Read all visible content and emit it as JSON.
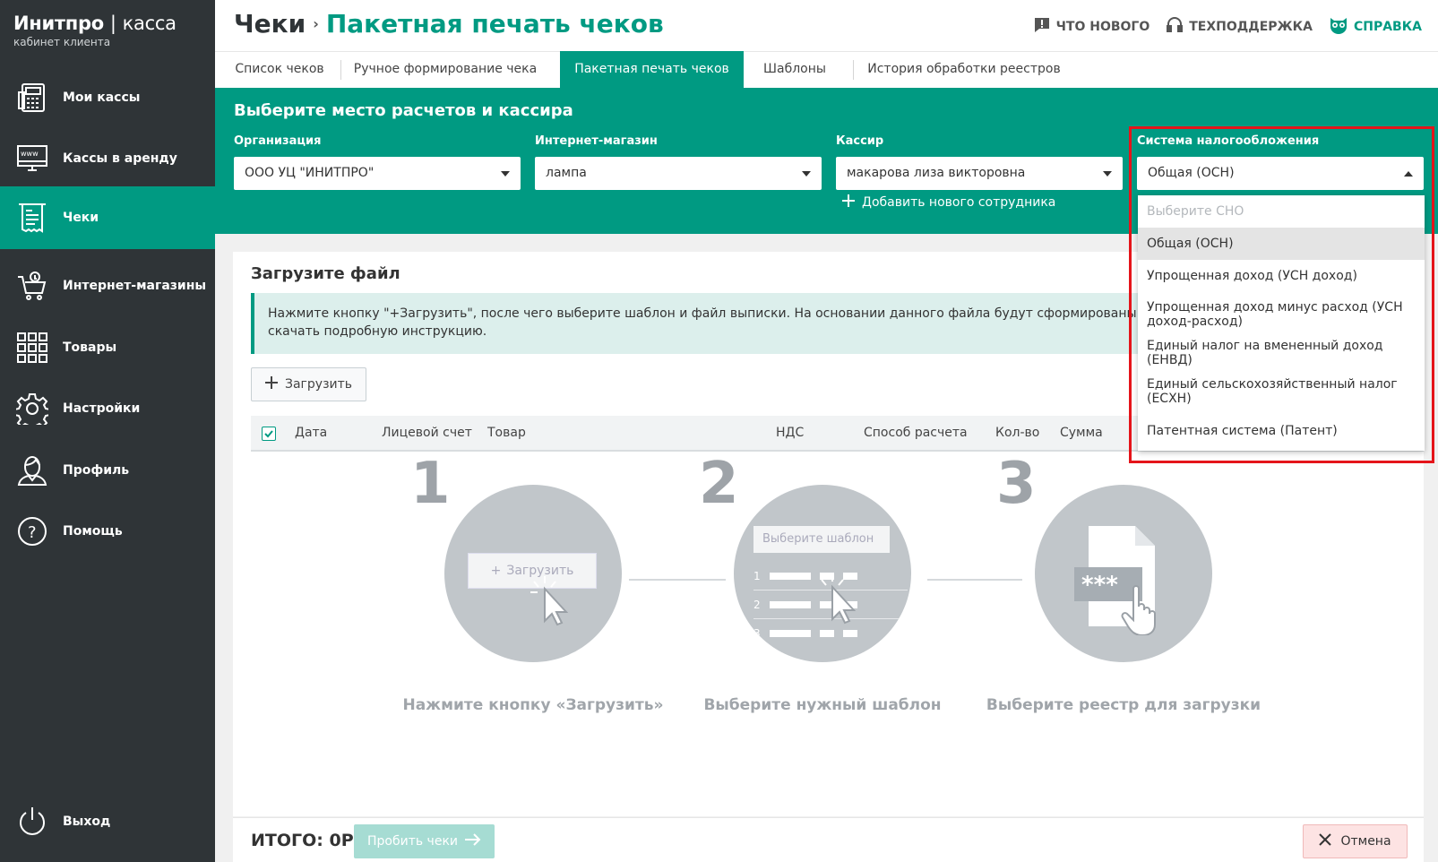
{
  "brand": {
    "name_bold": "Инитпро",
    "name_light": "касса",
    "subtitle": "кабинет клиента"
  },
  "sidebar": {
    "items": [
      {
        "label": "Мои кассы",
        "icon": "cash-register-icon"
      },
      {
        "label": "Кассы в аренду",
        "icon": "www-monitor-icon"
      },
      {
        "label": "Чеки",
        "icon": "receipt-icon",
        "active": true
      },
      {
        "label": "Интернет-магазины",
        "icon": "shopping-cart-icon"
      },
      {
        "label": "Товары",
        "icon": "grid-icon"
      },
      {
        "label": "Настройки",
        "icon": "gear-icon"
      },
      {
        "label": "Профиль",
        "icon": "user-icon"
      },
      {
        "label": "Помощь",
        "icon": "help-icon"
      }
    ],
    "logout": {
      "label": "Выход",
      "icon": "power-icon"
    }
  },
  "header": {
    "crumb_root": "Чеки",
    "crumb_separator": "›",
    "crumb_current": "Пакетная печать чеков",
    "links": {
      "whats_new": "ЧТО НОВОГО",
      "support": "ТЕХПОДДЕРЖКА",
      "help": "СПРАВКА"
    }
  },
  "tabs": [
    {
      "label": "Список чеков"
    },
    {
      "label": "Ручное формирование чека"
    },
    {
      "label": "Пакетная печать чеков",
      "active": true
    },
    {
      "label": "Шаблоны"
    },
    {
      "label": "История обработки реестров"
    }
  ],
  "band": {
    "title": "Выберите место расчетов и кассира",
    "fields": {
      "organization": {
        "label": "Организация",
        "value": "ООО УЦ \"ИНИТПРО\""
      },
      "shop": {
        "label": "Интернет-магазин",
        "value": "лампа"
      },
      "cashier": {
        "label": "Кассир",
        "value": "макарова лиза викторовна"
      },
      "tax": {
        "label": "Система налогообложения",
        "value": "Общая (ОСН)"
      }
    },
    "add_employee": "Добавить нового сотрудника"
  },
  "tax_dropdown": {
    "placeholder": "Выберите СНО",
    "options": [
      "Общая (ОСН)",
      "Упрощенная доход (УСН доход)",
      "Упрощенная доход минус расход (УСН доход-расход)",
      "Единый налог на вмененный доход (ЕНВД)",
      "Единый сельскохозяйственный налог (ЕСХН)",
      "Патентная система (Патент)"
    ],
    "selected_index": 0
  },
  "upload": {
    "title": "Загрузите файл",
    "info_line1": "Нажмите кнопку \"+Загрузить\", после чего выберите шаблон и файл выписки. На основании данного файла будут сформированы фискальные",
    "info_line2": "скачать подробную инструкцию.",
    "button": "Загрузить"
  },
  "table": {
    "columns": [
      "Дата",
      "Лицевой счет",
      "Товар",
      "НДС",
      "Способ расчета",
      "Кол-во",
      "Сумма"
    ]
  },
  "steps": [
    {
      "num": "1",
      "caption": "Нажмите кнопку «Загрузить»",
      "mock_button": "Загрузить"
    },
    {
      "num": "2",
      "caption": "Выберите нужный шаблон",
      "mock_select": "Выберите шаблон",
      "rows": [
        "1",
        "2",
        "3"
      ]
    },
    {
      "num": "3",
      "caption": "Выберите реестр для загрузки",
      "mask": "***"
    }
  ],
  "footer": {
    "total": "ИТОГО: 0Р",
    "submit": "Пробить чеки",
    "cancel": "Отмена"
  },
  "colors": {
    "accent": "#009a82",
    "sidebar": "#2f3437",
    "highlight": "#e5141a"
  }
}
